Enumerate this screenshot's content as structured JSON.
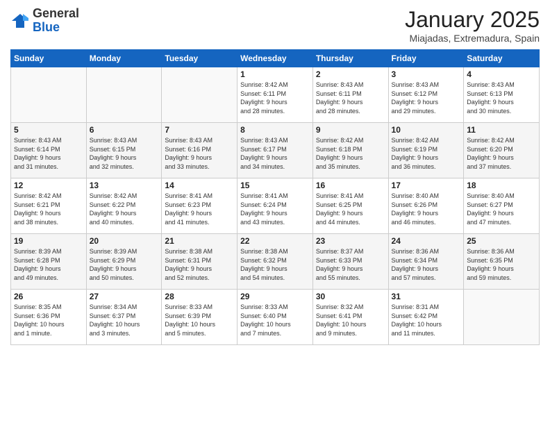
{
  "logo": {
    "general": "General",
    "blue": "Blue"
  },
  "title": "January 2025",
  "subtitle": "Miajadas, Extremadura, Spain",
  "headers": [
    "Sunday",
    "Monday",
    "Tuesday",
    "Wednesday",
    "Thursday",
    "Friday",
    "Saturday"
  ],
  "weeks": [
    [
      {
        "day": "",
        "info": ""
      },
      {
        "day": "",
        "info": ""
      },
      {
        "day": "",
        "info": ""
      },
      {
        "day": "1",
        "info": "Sunrise: 8:42 AM\nSunset: 6:11 PM\nDaylight: 9 hours\nand 28 minutes."
      },
      {
        "day": "2",
        "info": "Sunrise: 8:43 AM\nSunset: 6:11 PM\nDaylight: 9 hours\nand 28 minutes."
      },
      {
        "day": "3",
        "info": "Sunrise: 8:43 AM\nSunset: 6:12 PM\nDaylight: 9 hours\nand 29 minutes."
      },
      {
        "day": "4",
        "info": "Sunrise: 8:43 AM\nSunset: 6:13 PM\nDaylight: 9 hours\nand 30 minutes."
      }
    ],
    [
      {
        "day": "5",
        "info": "Sunrise: 8:43 AM\nSunset: 6:14 PM\nDaylight: 9 hours\nand 31 minutes."
      },
      {
        "day": "6",
        "info": "Sunrise: 8:43 AM\nSunset: 6:15 PM\nDaylight: 9 hours\nand 32 minutes."
      },
      {
        "day": "7",
        "info": "Sunrise: 8:43 AM\nSunset: 6:16 PM\nDaylight: 9 hours\nand 33 minutes."
      },
      {
        "day": "8",
        "info": "Sunrise: 8:43 AM\nSunset: 6:17 PM\nDaylight: 9 hours\nand 34 minutes."
      },
      {
        "day": "9",
        "info": "Sunrise: 8:42 AM\nSunset: 6:18 PM\nDaylight: 9 hours\nand 35 minutes."
      },
      {
        "day": "10",
        "info": "Sunrise: 8:42 AM\nSunset: 6:19 PM\nDaylight: 9 hours\nand 36 minutes."
      },
      {
        "day": "11",
        "info": "Sunrise: 8:42 AM\nSunset: 6:20 PM\nDaylight: 9 hours\nand 37 minutes."
      }
    ],
    [
      {
        "day": "12",
        "info": "Sunrise: 8:42 AM\nSunset: 6:21 PM\nDaylight: 9 hours\nand 38 minutes."
      },
      {
        "day": "13",
        "info": "Sunrise: 8:42 AM\nSunset: 6:22 PM\nDaylight: 9 hours\nand 40 minutes."
      },
      {
        "day": "14",
        "info": "Sunrise: 8:41 AM\nSunset: 6:23 PM\nDaylight: 9 hours\nand 41 minutes."
      },
      {
        "day": "15",
        "info": "Sunrise: 8:41 AM\nSunset: 6:24 PM\nDaylight: 9 hours\nand 43 minutes."
      },
      {
        "day": "16",
        "info": "Sunrise: 8:41 AM\nSunset: 6:25 PM\nDaylight: 9 hours\nand 44 minutes."
      },
      {
        "day": "17",
        "info": "Sunrise: 8:40 AM\nSunset: 6:26 PM\nDaylight: 9 hours\nand 46 minutes."
      },
      {
        "day": "18",
        "info": "Sunrise: 8:40 AM\nSunset: 6:27 PM\nDaylight: 9 hours\nand 47 minutes."
      }
    ],
    [
      {
        "day": "19",
        "info": "Sunrise: 8:39 AM\nSunset: 6:28 PM\nDaylight: 9 hours\nand 49 minutes."
      },
      {
        "day": "20",
        "info": "Sunrise: 8:39 AM\nSunset: 6:29 PM\nDaylight: 9 hours\nand 50 minutes."
      },
      {
        "day": "21",
        "info": "Sunrise: 8:38 AM\nSunset: 6:31 PM\nDaylight: 9 hours\nand 52 minutes."
      },
      {
        "day": "22",
        "info": "Sunrise: 8:38 AM\nSunset: 6:32 PM\nDaylight: 9 hours\nand 54 minutes."
      },
      {
        "day": "23",
        "info": "Sunrise: 8:37 AM\nSunset: 6:33 PM\nDaylight: 9 hours\nand 55 minutes."
      },
      {
        "day": "24",
        "info": "Sunrise: 8:36 AM\nSunset: 6:34 PM\nDaylight: 9 hours\nand 57 minutes."
      },
      {
        "day": "25",
        "info": "Sunrise: 8:36 AM\nSunset: 6:35 PM\nDaylight: 9 hours\nand 59 minutes."
      }
    ],
    [
      {
        "day": "26",
        "info": "Sunrise: 8:35 AM\nSunset: 6:36 PM\nDaylight: 10 hours\nand 1 minute."
      },
      {
        "day": "27",
        "info": "Sunrise: 8:34 AM\nSunset: 6:37 PM\nDaylight: 10 hours\nand 3 minutes."
      },
      {
        "day": "28",
        "info": "Sunrise: 8:33 AM\nSunset: 6:39 PM\nDaylight: 10 hours\nand 5 minutes."
      },
      {
        "day": "29",
        "info": "Sunrise: 8:33 AM\nSunset: 6:40 PM\nDaylight: 10 hours\nand 7 minutes."
      },
      {
        "day": "30",
        "info": "Sunrise: 8:32 AM\nSunset: 6:41 PM\nDaylight: 10 hours\nand 9 minutes."
      },
      {
        "day": "31",
        "info": "Sunrise: 8:31 AM\nSunset: 6:42 PM\nDaylight: 10 hours\nand 11 minutes."
      },
      {
        "day": "",
        "info": ""
      }
    ]
  ]
}
